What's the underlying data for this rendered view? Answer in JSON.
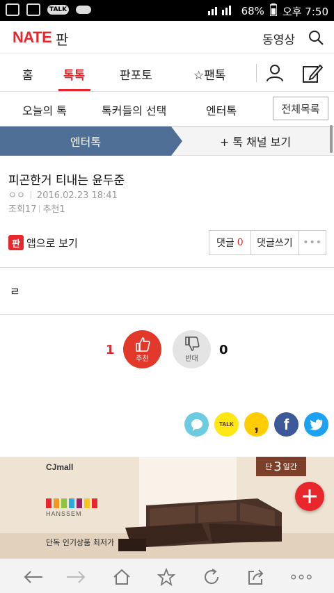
{
  "status_bar": {
    "talk_badge": "TALK",
    "battery": "68%",
    "time": "오후 7:50"
  },
  "header": {
    "logo": "NATE",
    "logo_suffix": "판",
    "video_link": "동영상"
  },
  "nav": {
    "tabs": [
      {
        "label": "홈"
      },
      {
        "label": "톡톡",
        "active": true
      },
      {
        "label": "판포토"
      },
      {
        "label": "☆팬톡"
      }
    ]
  },
  "subnav": {
    "items": [
      {
        "label": "오늘의 톡"
      },
      {
        "label": "톡커들의 선택"
      },
      {
        "label": "엔터톡"
      }
    ],
    "all_button": "전체목록"
  },
  "channel": {
    "active": "엔터톡",
    "other": "+ 톡 채널 보기"
  },
  "post": {
    "title": "피곤한거 티내는 윤두준",
    "author": "ㅇㅇ",
    "date": "2016.02.23 18:41",
    "views_label": "조회17",
    "recommend_label": "추천1",
    "body": "ㄹ"
  },
  "actions": {
    "app_icon_char": "판",
    "app_view": "앱으로 보기",
    "comments_label": "댓글",
    "comments_count": "0",
    "write_comment": "댓글쓰기",
    "more": "•••"
  },
  "vote": {
    "up_count": "1",
    "up_label": "추천",
    "down_label": "반대",
    "down_count": "0"
  },
  "share": {
    "talk_label": "TALK",
    "story_label": ",",
    "facebook_label": "f"
  },
  "ad": {
    "brand_mall": "CJmall",
    "ribbon_prefix": "단",
    "ribbon_num": "3",
    "ribbon_suffix": "일간",
    "brand_name": "HANSSEM",
    "subtitle": "단독 인기상품 최저가"
  },
  "colors": {
    "brand_red": "#e8262c",
    "channel_active": "#4e6e95",
    "kakao_yellow": "#ffe812",
    "facebook": "#3b5998",
    "twitter": "#1da1f2"
  }
}
